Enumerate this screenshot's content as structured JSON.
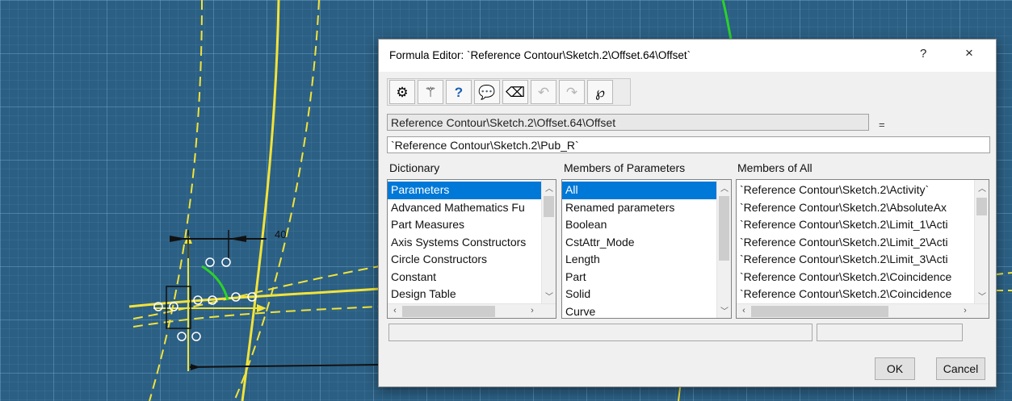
{
  "dialog": {
    "title": "Formula Editor: `Reference Contour\\Sketch.2\\Offset.64\\Offset`",
    "help_label": "?",
    "close_label": "×"
  },
  "toolbar": {
    "tools": [
      {
        "icon": "dictionary-icon",
        "glyph": "⚙",
        "enabled": true
      },
      {
        "icon": "wizard-wand-icon",
        "glyph": "⚚",
        "enabled": true
      },
      {
        "icon": "help-book-icon",
        "glyph": "?",
        "enabled": true
      },
      {
        "icon": "comment-bubble-icon",
        "glyph": "💬",
        "enabled": true
      },
      {
        "icon": "eraser-icon",
        "glyph": "⌫",
        "enabled": true
      },
      {
        "icon": "undo-icon",
        "glyph": "↶",
        "enabled": false
      },
      {
        "icon": "redo-icon",
        "glyph": "↷",
        "enabled": false
      },
      {
        "icon": "parameter-select-icon",
        "glyph": "℘",
        "enabled": true
      }
    ]
  },
  "parameter": {
    "name": "Reference Contour\\Sketch.2\\Offset.64\\Offset",
    "equals": "="
  },
  "formula": {
    "value": "`Reference Contour\\Sketch.2\\Pub_R`"
  },
  "dictionary": {
    "label": "Dictionary",
    "items": [
      "Parameters",
      "Advanced Mathematics Fu",
      "Part Measures",
      "Axis Systems Constructors",
      "Circle Constructors",
      "Constant",
      "Design Table"
    ],
    "selected": 0
  },
  "members_params": {
    "label": "Members of Parameters",
    "items": [
      "All",
      "Renamed parameters",
      "Boolean",
      "CstAttr_Mode",
      "Length",
      "Part",
      "Solid",
      "Curve"
    ],
    "selected": 0
  },
  "members_all": {
    "label": "Members of All",
    "items": [
      "`Reference Contour\\Sketch.2\\Activity`",
      "`Reference Contour\\Sketch.2\\AbsoluteAx",
      "`Reference Contour\\Sketch.2\\Limit_1\\Acti",
      "`Reference Contour\\Sketch.2\\Limit_2\\Acti",
      "`Reference Contour\\Sketch.2\\Limit_3\\Acti",
      "`Reference Contour\\Sketch.2\\Coincidence",
      "`Reference Contour\\Sketch.2\\Coincidence"
    ]
  },
  "buttons": {
    "ok": "OK",
    "cancel": "Cancel"
  },
  "sketch": {
    "dimension_label": "40"
  }
}
